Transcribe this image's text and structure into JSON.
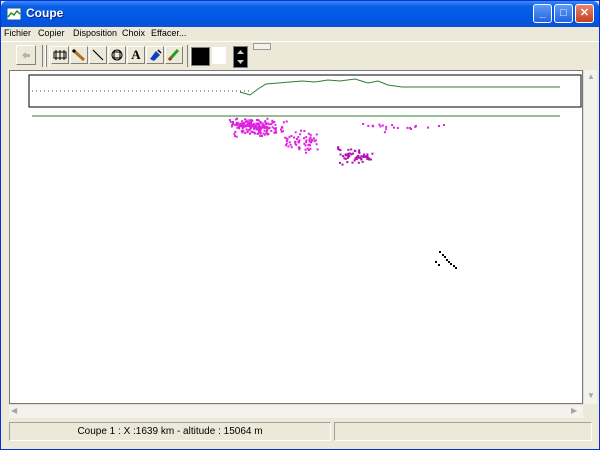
{
  "window": {
    "title": "Coupe"
  },
  "menu": [
    "Fichier",
    "Copier",
    "Disposition",
    "Choix",
    "Effacer..."
  ],
  "toolbar": {
    "text_tool_label": "A",
    "tools": [
      "undo-icon",
      "altitude-profile-icon",
      "pencil-icon",
      "line-icon",
      "shape-icon",
      "text-icon",
      "fill-icon",
      "marker-icon"
    ],
    "selected_color": "#000000"
  },
  "profile": {
    "color": "#2e7d2e"
  },
  "plot": {
    "point_colors": [
      "#e020e0",
      "#b010b0",
      "#000000"
    ]
  },
  "status": {
    "text": "Coupe 1 : X :1639 km  - altitude : 15064 m",
    "second_pane": ""
  }
}
